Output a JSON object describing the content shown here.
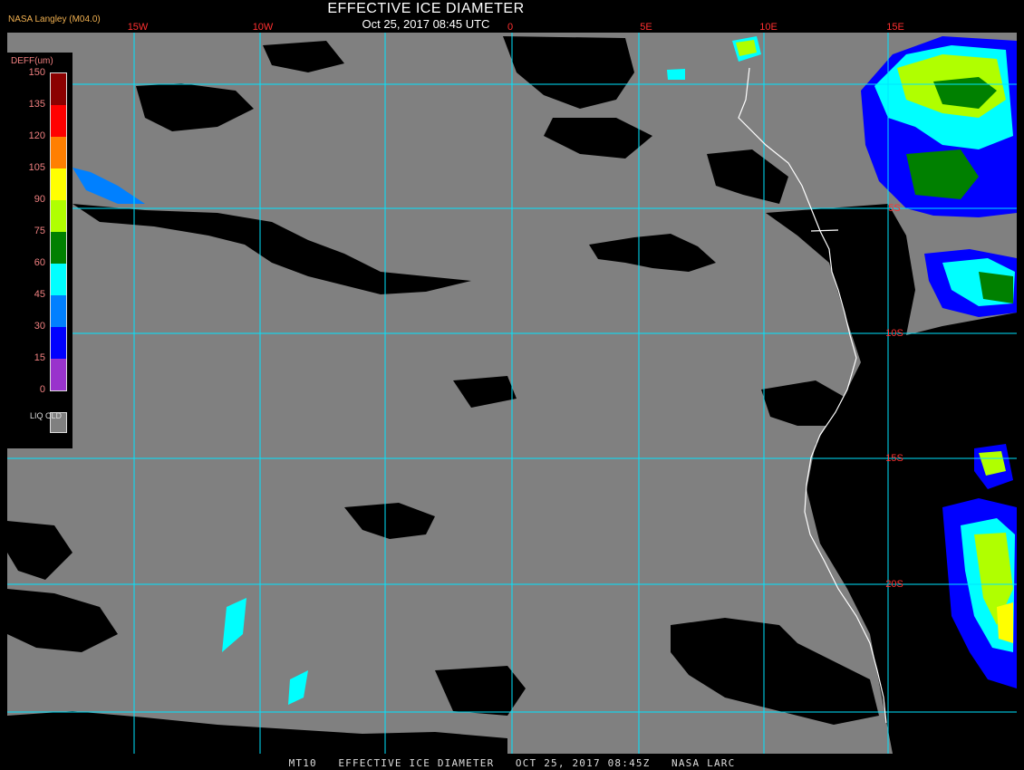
{
  "header": {
    "title": "EFFECTIVE ICE DIAMETER",
    "datetime": "Oct 25, 2017 08:45 UTC",
    "org": "NASA Langley (M04.0)"
  },
  "footer": {
    "product": "MT10",
    "name": "EFFECTIVE ICE DIAMETER",
    "datetime": "OCT 25, 2017 08:45Z",
    "source": "NASA LARC"
  },
  "legend": {
    "unit_label": "DEFF(um)",
    "ticks": [
      "150",
      "135",
      "120",
      "105",
      "90",
      "75",
      "60",
      "45",
      "30",
      "15",
      "0"
    ],
    "colors": [
      "#8b0000",
      "#ff0000",
      "#ff7f00",
      "#ffff00",
      "#b0ff00",
      "#008000",
      "#00ffff",
      "#0080ff",
      "#0000ff",
      "#9933cc"
    ],
    "liq_label": "LIQ CLD",
    "liq_color": "#808080"
  },
  "map": {
    "lon_labels": [
      "15W",
      "10W",
      "0",
      "5E",
      "10E",
      "15E"
    ],
    "lat_labels": [
      "5S",
      "10S",
      "15S",
      "20S"
    ],
    "grid_color": "#00e5ff",
    "label_color": "#ff3030",
    "background_liquid": "#808080",
    "clear_sky": "#000000",
    "coast_color": "#ffffff"
  }
}
